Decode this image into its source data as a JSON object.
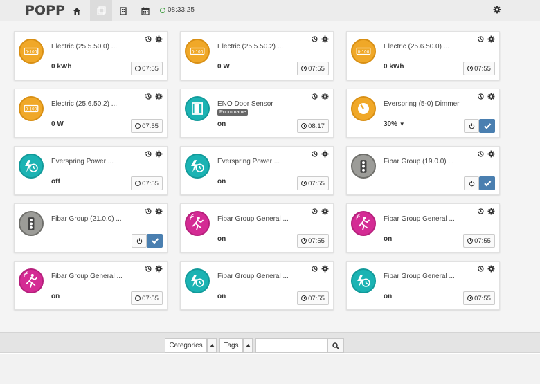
{
  "app": {
    "logo": "POPP",
    "clock": "08:33:25"
  },
  "nav": {
    "home_icon": "home-icon",
    "elements_icon": "elements-icon",
    "rooms_icon": "rooms-icon",
    "events_icon": "calendar-icon",
    "settings_icon": "gear-icon"
  },
  "devices": [
    {
      "title": "Electric (25.5.50.0) ...",
      "value": "0 kWh",
      "time": "07:55",
      "icon": "meter-icon",
      "color": "#f0a828"
    },
    {
      "title": "Electric (25.5.50.2) ...",
      "value": "0 W",
      "time": "07:55",
      "icon": "meter-icon",
      "color": "#f0a828"
    },
    {
      "title": "Electric (25.6.50.0) ...",
      "value": "0 kWh",
      "time": "07:55",
      "icon": "meter-icon",
      "color": "#f0a828"
    },
    {
      "title": "Electric (25.6.50.2) ...",
      "value": "0 W",
      "time": "07:55",
      "icon": "meter-icon",
      "color": "#f0a828"
    },
    {
      "title": "ENO Door Sensor",
      "room_tag": "Room name",
      "value": "on",
      "time": "08:17",
      "icon": "door-icon",
      "color": "#1bb3b3"
    },
    {
      "title": "Everspring (5-0) Dimmer",
      "value": "30%",
      "icon": "dimmer-icon",
      "color": "#f0a828"
    },
    {
      "title": "Everspring Power ...",
      "value": "off",
      "time": "07:55",
      "icon": "power-clock-icon",
      "color": "#1bb3b3"
    },
    {
      "title": "Everspring Power ...",
      "value": "on",
      "time": "07:55",
      "icon": "power-clock-icon",
      "color": "#1bb3b3"
    },
    {
      "title": "Fibar Group (19.0.0) ...",
      "icon": "traffic-light-icon",
      "color": "#9c9c98"
    },
    {
      "title": "Fibar Group (21.0.0) ...",
      "icon": "traffic-light-icon",
      "color": "#9c9c98"
    },
    {
      "title": "Fibar Group General ...",
      "value": "on",
      "time": "07:55",
      "icon": "motion-icon",
      "color": "#d42b94"
    },
    {
      "title": "Fibar Group General ...",
      "value": "on",
      "time": "07:55",
      "icon": "motion-icon",
      "color": "#d42b94"
    },
    {
      "title": "Fibar Group General ...",
      "value": "on",
      "time": "07:55",
      "icon": "motion-icon",
      "color": "#d42b94"
    },
    {
      "title": "Fibar Group General ...",
      "value": "on",
      "time": "07:55",
      "icon": "power-clock-icon",
      "color": "#1bb3b3"
    },
    {
      "title": "Fibar Group General ...",
      "value": "on",
      "time": "07:55",
      "icon": "power-clock-icon",
      "color": "#1bb3b3"
    }
  ],
  "filters": {
    "categories_label": "Categories",
    "tags_label": "Tags",
    "search_placeholder": ""
  }
}
